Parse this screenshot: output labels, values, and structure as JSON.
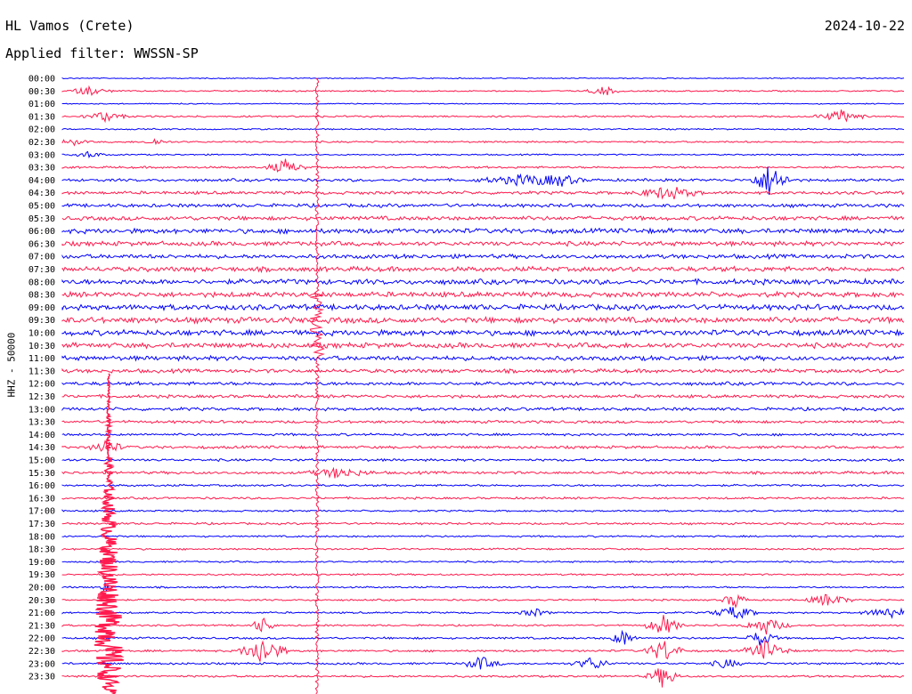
{
  "header": {
    "station": "HL Vamos (Crete)",
    "date": "2024-10-22",
    "filter_label": "Applied filter: WWSSN-SP"
  },
  "chart_data": {
    "type": "line",
    "ylabel": "HHZ - 50000",
    "colors": [
      "#0000ff",
      "#ff1a4d"
    ],
    "row_labels": [
      "00:00",
      "00:30",
      "01:00",
      "01:30",
      "02:00",
      "02:30",
      "03:00",
      "03:30",
      "04:00",
      "04:30",
      "05:00",
      "05:30",
      "06:00",
      "06:30",
      "07:00",
      "07:30",
      "08:00",
      "08:30",
      "09:00",
      "09:30",
      "10:00",
      "10:30",
      "11:00",
      "11:30",
      "12:00",
      "12:30",
      "13:00",
      "13:30",
      "14:00",
      "14:30",
      "15:00",
      "15:30",
      "16:00",
      "16:30",
      "17:00",
      "17:30",
      "18:00",
      "18:30",
      "19:00",
      "19:30",
      "20:00",
      "20:30",
      "21:00",
      "21:30",
      "22:00",
      "22:30",
      "23:00",
      "23:30"
    ],
    "row_activity": [
      0.3,
      0.4,
      0.3,
      0.5,
      0.4,
      0.5,
      0.4,
      0.6,
      0.8,
      0.9,
      1.0,
      1.2,
      1.4,
      1.3,
      1.2,
      1.4,
      1.5,
      1.5,
      1.6,
      1.7,
      1.6,
      1.5,
      1.3,
      1.1,
      1.0,
      0.9,
      0.9,
      0.8,
      0.7,
      0.8,
      0.7,
      0.8,
      0.6,
      0.6,
      0.5,
      0.6,
      0.5,
      0.5,
      0.5,
      0.5,
      0.5,
      0.5,
      0.5,
      0.5,
      0.6,
      0.6,
      0.6,
      0.6
    ]
  }
}
